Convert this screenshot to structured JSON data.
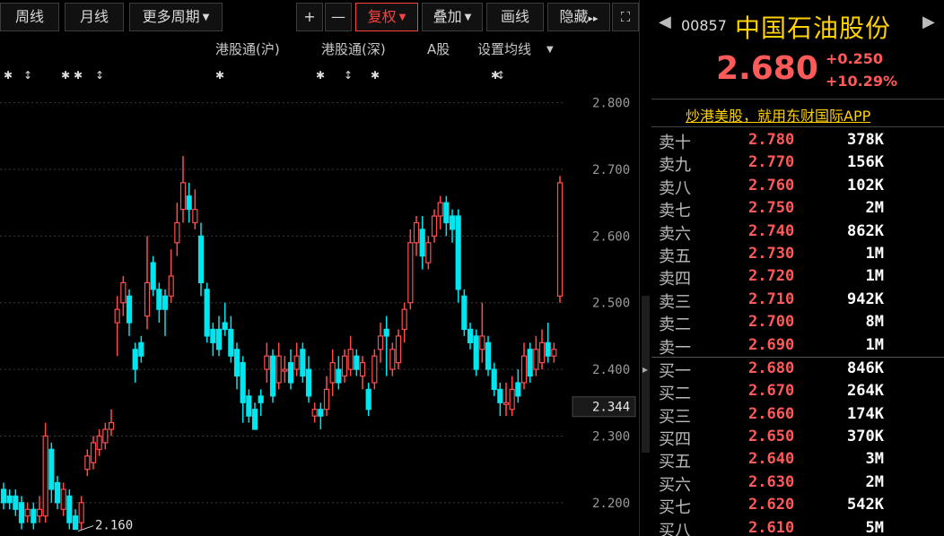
{
  "toolbar": {
    "weekly": "周线",
    "monthly": "月线",
    "more_periods": "更多周期",
    "plus": "+",
    "minus": "—",
    "adjust": "复权",
    "overlay": "叠加",
    "draw": "画线",
    "hide": "隐藏",
    "hide_arrows": "▸▸",
    "fullscreen_icon": "⛶"
  },
  "subbar": {
    "sh_connect": "港股通(沪)",
    "sz_connect": "港股通(深)",
    "a_share": "A股",
    "ma_settings": "设置均线"
  },
  "colors": {
    "up": "#ff4d4d",
    "down": "#00e5ee",
    "accent": "#ffd200",
    "grid": "#3a3a3a"
  },
  "chart_data": {
    "type": "candlestick",
    "y_ticks": [
      "2.800",
      "2.700",
      "2.600",
      "2.500",
      "2.400",
      "2.300",
      "2.200"
    ],
    "ylim": [
      2.15,
      2.86
    ],
    "current_price_label": "2.344",
    "min_marker": "2.160",
    "grid": true,
    "candles": [
      {
        "o": 2.22,
        "c": 2.2,
        "h": 2.23,
        "l": 2.19
      },
      {
        "o": 2.21,
        "c": 2.2,
        "h": 2.22,
        "l": 2.19
      },
      {
        "o": 2.21,
        "c": 2.19,
        "h": 2.22,
        "l": 2.18
      },
      {
        "o": 2.2,
        "c": 2.17,
        "h": 2.21,
        "l": 2.16
      },
      {
        "o": 2.18,
        "c": 2.19,
        "h": 2.2,
        "l": 2.17
      },
      {
        "o": 2.19,
        "c": 2.17,
        "h": 2.2,
        "l": 2.16
      },
      {
        "o": 2.18,
        "c": 2.19,
        "h": 2.21,
        "l": 2.17
      },
      {
        "o": 2.18,
        "c": 2.3,
        "h": 2.32,
        "l": 2.17
      },
      {
        "o": 2.28,
        "c": 2.22,
        "h": 2.29,
        "l": 2.2
      },
      {
        "o": 2.23,
        "c": 2.2,
        "h": 2.24,
        "l": 2.19
      },
      {
        "o": 2.19,
        "c": 2.22,
        "h": 2.23,
        "l": 2.18
      },
      {
        "o": 2.21,
        "c": 2.17,
        "h": 2.22,
        "l": 2.16
      },
      {
        "o": 2.18,
        "c": 2.16,
        "h": 2.19,
        "l": 2.16
      },
      {
        "o": 2.17,
        "c": 2.2,
        "h": 2.21,
        "l": 2.16
      },
      {
        "o": 2.25,
        "c": 2.27,
        "h": 2.28,
        "l": 2.24
      },
      {
        "o": 2.26,
        "c": 2.29,
        "h": 2.3,
        "l": 2.25
      },
      {
        "o": 2.28,
        "c": 2.3,
        "h": 2.31,
        "l": 2.27
      },
      {
        "o": 2.29,
        "c": 2.31,
        "h": 2.32,
        "l": 2.28
      },
      {
        "o": 2.31,
        "c": 2.32,
        "h": 2.34,
        "l": 2.3
      },
      {
        "o": 2.47,
        "c": 2.49,
        "h": 2.51,
        "l": 2.42
      },
      {
        "o": 2.5,
        "c": 2.53,
        "h": 2.54,
        "l": 2.48
      },
      {
        "o": 2.51,
        "c": 2.47,
        "h": 2.52,
        "l": 2.45
      },
      {
        "o": 2.43,
        "c": 2.4,
        "h": 2.44,
        "l": 2.38
      },
      {
        "o": 2.44,
        "c": 2.42,
        "h": 2.45,
        "l": 2.41
      },
      {
        "o": 2.48,
        "c": 2.53,
        "h": 2.6,
        "l": 2.46
      },
      {
        "o": 2.56,
        "c": 2.52,
        "h": 2.57,
        "l": 2.51
      },
      {
        "o": 2.52,
        "c": 2.49,
        "h": 2.53,
        "l": 2.47
      },
      {
        "o": 2.51,
        "c": 2.49,
        "h": 2.52,
        "l": 2.45
      },
      {
        "o": 2.51,
        "c": 2.54,
        "h": 2.58,
        "l": 2.5
      },
      {
        "o": 2.59,
        "c": 2.62,
        "h": 2.65,
        "l": 2.57
      },
      {
        "o": 2.64,
        "c": 2.68,
        "h": 2.72,
        "l": 2.62
      },
      {
        "o": 2.66,
        "c": 2.64,
        "h": 2.68,
        "l": 2.62
      },
      {
        "o": 2.62,
        "c": 2.64,
        "h": 2.67,
        "l": 2.61
      },
      {
        "o": 2.6,
        "c": 2.53,
        "h": 2.62,
        "l": 2.51
      },
      {
        "o": 2.52,
        "c": 2.45,
        "h": 2.53,
        "l": 2.44
      },
      {
        "o": 2.46,
        "c": 2.44,
        "h": 2.47,
        "l": 2.42
      },
      {
        "o": 2.46,
        "c": 2.43,
        "h": 2.48,
        "l": 2.42
      },
      {
        "o": 2.47,
        "c": 2.46,
        "h": 2.5,
        "l": 2.45
      },
      {
        "o": 2.46,
        "c": 2.42,
        "h": 2.48,
        "l": 2.41
      },
      {
        "o": 2.43,
        "c": 2.39,
        "h": 2.44,
        "l": 2.37
      },
      {
        "o": 2.41,
        "c": 2.35,
        "h": 2.42,
        "l": 2.32
      },
      {
        "o": 2.36,
        "c": 2.33,
        "h": 2.37,
        "l": 2.32
      },
      {
        "o": 2.34,
        "c": 2.31,
        "h": 2.35,
        "l": 2.31
      },
      {
        "o": 2.36,
        "c": 2.35,
        "h": 2.37,
        "l": 2.33
      },
      {
        "o": 2.4,
        "c": 2.42,
        "h": 2.44,
        "l": 2.38
      },
      {
        "o": 2.42,
        "c": 2.36,
        "h": 2.43,
        "l": 2.35
      },
      {
        "o": 2.38,
        "c": 2.42,
        "h": 2.44,
        "l": 2.37
      },
      {
        "o": 2.4,
        "c": 2.4,
        "h": 2.42,
        "l": 2.38
      },
      {
        "o": 2.41,
        "c": 2.38,
        "h": 2.43,
        "l": 2.37
      },
      {
        "o": 2.4,
        "c": 2.42,
        "h": 2.44,
        "l": 2.39
      },
      {
        "o": 2.43,
        "c": 2.39,
        "h": 2.44,
        "l": 2.38
      },
      {
        "o": 2.4,
        "c": 2.36,
        "h": 2.42,
        "l": 2.35
      },
      {
        "o": 2.33,
        "c": 2.34,
        "h": 2.35,
        "l": 2.32
      },
      {
        "o": 2.34,
        "c": 2.33,
        "h": 2.35,
        "l": 2.31
      },
      {
        "o": 2.34,
        "c": 2.37,
        "h": 2.39,
        "l": 2.33
      },
      {
        "o": 2.38,
        "c": 2.41,
        "h": 2.43,
        "l": 2.36
      },
      {
        "o": 2.4,
        "c": 2.38,
        "h": 2.42,
        "l": 2.37
      },
      {
        "o": 2.39,
        "c": 2.42,
        "h": 2.43,
        "l": 2.38
      },
      {
        "o": 2.4,
        "c": 2.43,
        "h": 2.45,
        "l": 2.39
      },
      {
        "o": 2.42,
        "c": 2.4,
        "h": 2.43,
        "l": 2.39
      },
      {
        "o": 2.39,
        "c": 2.41,
        "h": 2.42,
        "l": 2.37
      },
      {
        "o": 2.37,
        "c": 2.34,
        "h": 2.38,
        "l": 2.33
      },
      {
        "o": 2.38,
        "c": 2.42,
        "h": 2.43,
        "l": 2.37
      },
      {
        "o": 2.43,
        "c": 2.45,
        "h": 2.47,
        "l": 2.41
      },
      {
        "o": 2.46,
        "c": 2.45,
        "h": 2.48,
        "l": 2.39
      },
      {
        "o": 2.4,
        "c": 2.43,
        "h": 2.44,
        "l": 2.39
      },
      {
        "o": 2.41,
        "c": 2.45,
        "h": 2.46,
        "l": 2.4
      },
      {
        "o": 2.46,
        "c": 2.49,
        "h": 2.5,
        "l": 2.44
      },
      {
        "o": 2.5,
        "c": 2.59,
        "h": 2.61,
        "l": 2.49
      },
      {
        "o": 2.59,
        "c": 2.62,
        "h": 2.63,
        "l": 2.57
      },
      {
        "o": 2.61,
        "c": 2.57,
        "h": 2.63,
        "l": 2.55
      },
      {
        "o": 2.56,
        "c": 2.59,
        "h": 2.6,
        "l": 2.55
      },
      {
        "o": 2.6,
        "c": 2.63,
        "h": 2.64,
        "l": 2.59
      },
      {
        "o": 2.63,
        "c": 2.65,
        "h": 2.66,
        "l": 2.61
      },
      {
        "o": 2.65,
        "c": 2.62,
        "h": 2.66,
        "l": 2.6
      },
      {
        "o": 2.63,
        "c": 2.61,
        "h": 2.64,
        "l": 2.59
      },
      {
        "o": 2.63,
        "c": 2.52,
        "h": 2.64,
        "l": 2.5
      },
      {
        "o": 2.51,
        "c": 2.46,
        "h": 2.52,
        "l": 2.45
      },
      {
        "o": 2.46,
        "c": 2.44,
        "h": 2.47,
        "l": 2.43
      },
      {
        "o": 2.45,
        "c": 2.4,
        "h": 2.46,
        "l": 2.39
      },
      {
        "o": 2.43,
        "c": 2.45,
        "h": 2.5,
        "l": 2.41
      },
      {
        "o": 2.44,
        "c": 2.4,
        "h": 2.45,
        "l": 2.39
      },
      {
        "o": 2.4,
        "c": 2.37,
        "h": 2.41,
        "l": 2.36
      },
      {
        "o": 2.37,
        "c": 2.35,
        "h": 2.38,
        "l": 2.33
      },
      {
        "o": 2.35,
        "c": 2.35,
        "h": 2.38,
        "l": 2.33
      },
      {
        "o": 2.34,
        "c": 2.37,
        "h": 2.39,
        "l": 2.33
      },
      {
        "o": 2.38,
        "c": 2.36,
        "h": 2.4,
        "l": 2.35
      },
      {
        "o": 2.38,
        "c": 2.42,
        "h": 2.44,
        "l": 2.37
      },
      {
        "o": 2.43,
        "c": 2.39,
        "h": 2.44,
        "l": 2.38
      },
      {
        "o": 2.4,
        "c": 2.43,
        "h": 2.45,
        "l": 2.39
      },
      {
        "o": 2.41,
        "c": 2.44,
        "h": 2.46,
        "l": 2.4
      },
      {
        "o": 2.44,
        "c": 2.42,
        "h": 2.47,
        "l": 2.41
      },
      {
        "o": 2.42,
        "c": 2.43,
        "h": 2.44,
        "l": 2.41
      },
      {
        "o": 2.51,
        "c": 2.68,
        "h": 2.69,
        "l": 2.5
      }
    ]
  },
  "stock": {
    "code": "00857",
    "name": "中国石油股份",
    "price": "2.680",
    "change": "+0.250",
    "change_pct": "+10.29%",
    "nav_left": "◀",
    "nav_right": "▶"
  },
  "banner": "炒港美股，就用东财国际APP",
  "order_book": {
    "asks": [
      {
        "label": "卖十",
        "price": "2.780",
        "vol": "378K"
      },
      {
        "label": "卖九",
        "price": "2.770",
        "vol": "156K"
      },
      {
        "label": "卖八",
        "price": "2.760",
        "vol": "102K"
      },
      {
        "label": "卖七",
        "price": "2.750",
        "vol": "2M"
      },
      {
        "label": "卖六",
        "price": "2.740",
        "vol": "862K"
      },
      {
        "label": "卖五",
        "price": "2.730",
        "vol": "1M"
      },
      {
        "label": "卖四",
        "price": "2.720",
        "vol": "1M"
      },
      {
        "label": "卖三",
        "price": "2.710",
        "vol": "942K"
      },
      {
        "label": "卖二",
        "price": "2.700",
        "vol": "8M"
      },
      {
        "label": "卖一",
        "price": "2.690",
        "vol": "1M"
      }
    ],
    "bids": [
      {
        "label": "买一",
        "price": "2.680",
        "vol": "846K"
      },
      {
        "label": "买二",
        "price": "2.670",
        "vol": "264K"
      },
      {
        "label": "买三",
        "price": "2.660",
        "vol": "174K"
      },
      {
        "label": "买四",
        "price": "2.650",
        "vol": "370K"
      },
      {
        "label": "买五",
        "price": "2.640",
        "vol": "3M"
      },
      {
        "label": "买六",
        "price": "2.630",
        "vol": "2M"
      },
      {
        "label": "买七",
        "price": "2.620",
        "vol": "542K"
      },
      {
        "label": "买八",
        "price": "2.610",
        "vol": "5M"
      }
    ]
  }
}
